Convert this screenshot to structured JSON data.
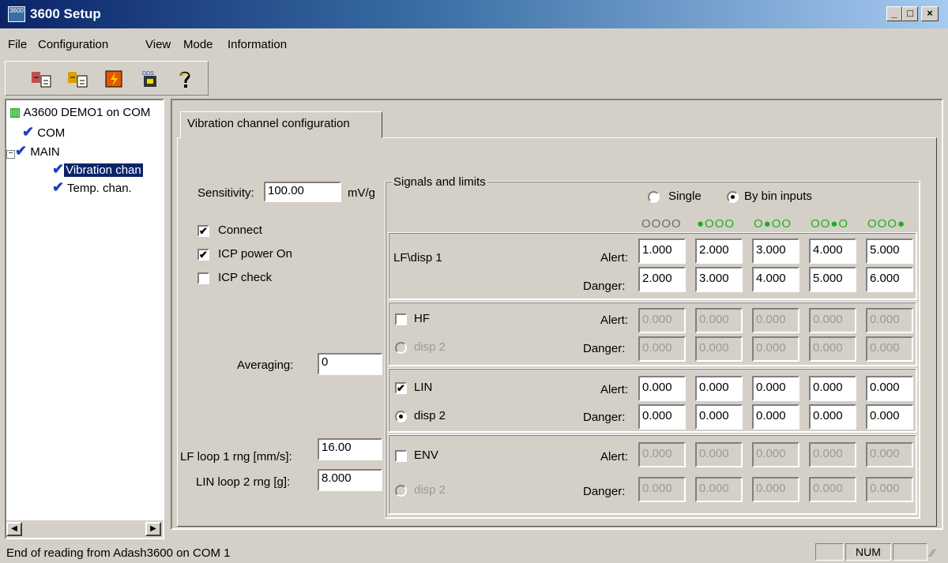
{
  "window": {
    "title": "3600 Setup",
    "icon_label": "3600",
    "min": "_",
    "max": "□",
    "close": "×"
  },
  "menu": {
    "file": "File",
    "configuration": "Configuration",
    "view": "View",
    "mode": "Mode",
    "information": "Information"
  },
  "tree": {
    "root": "A3600 DEMO1 on COM",
    "com": "COM",
    "main": "MAIN",
    "vibration": "Vibration chan",
    "temp": "Temp. chan.",
    "expander": "−"
  },
  "tab": {
    "label": "Vibration channel configuration"
  },
  "left": {
    "sensitivity_label": "Sensitivity:",
    "sensitivity_value": "100.00",
    "sensitivity_unit": "mV/g",
    "connect": "Connect",
    "icp_power": "ICP power On",
    "icp_check": "ICP check",
    "averaging_label": "Averaging:",
    "averaging_value": "0",
    "lf_loop_label": "LF loop 1 rng [mm/s]:",
    "lf_loop_value": "16.00",
    "lin_loop_label": "LIN loop 2 rng [g]:",
    "lin_loop_value": "8.000"
  },
  "signals": {
    "title": "Signals and limits",
    "single": "Single",
    "by_bin": "By bin inputs",
    "leds": [
      "OOOO",
      "●OOO",
      "O●OO",
      "OO●O",
      "OOO●"
    ],
    "alert": "Alert:",
    "danger": "Danger:",
    "rows": [
      {
        "name": "LF\\disp 1",
        "alert": [
          "1.000",
          "2.000",
          "3.000",
          "4.000",
          "5.000"
        ],
        "danger": [
          "2.000",
          "3.000",
          "4.000",
          "5.000",
          "6.000"
        ]
      },
      {
        "name": "HF",
        "sub": "disp 2",
        "alert": [
          "0.000",
          "0.000",
          "0.000",
          "0.000",
          "0.000"
        ],
        "danger": [
          "0.000",
          "0.000",
          "0.000",
          "0.000",
          "0.000"
        ]
      },
      {
        "name": "LIN",
        "sub": "disp 2",
        "alert": [
          "0.000",
          "0.000",
          "0.000",
          "0.000",
          "0.000"
        ],
        "danger": [
          "0.000",
          "0.000",
          "0.000",
          "0.000",
          "0.000"
        ]
      },
      {
        "name": "ENV",
        "sub": "disp 2",
        "alert": [
          "0.000",
          "0.000",
          "0.000",
          "0.000",
          "0.000"
        ],
        "danger": [
          "0.000",
          "0.000",
          "0.000",
          "0.000",
          "0.000"
        ]
      }
    ]
  },
  "status": {
    "message": "End of reading from Adash3600 on COM 1",
    "num": "NUM"
  }
}
